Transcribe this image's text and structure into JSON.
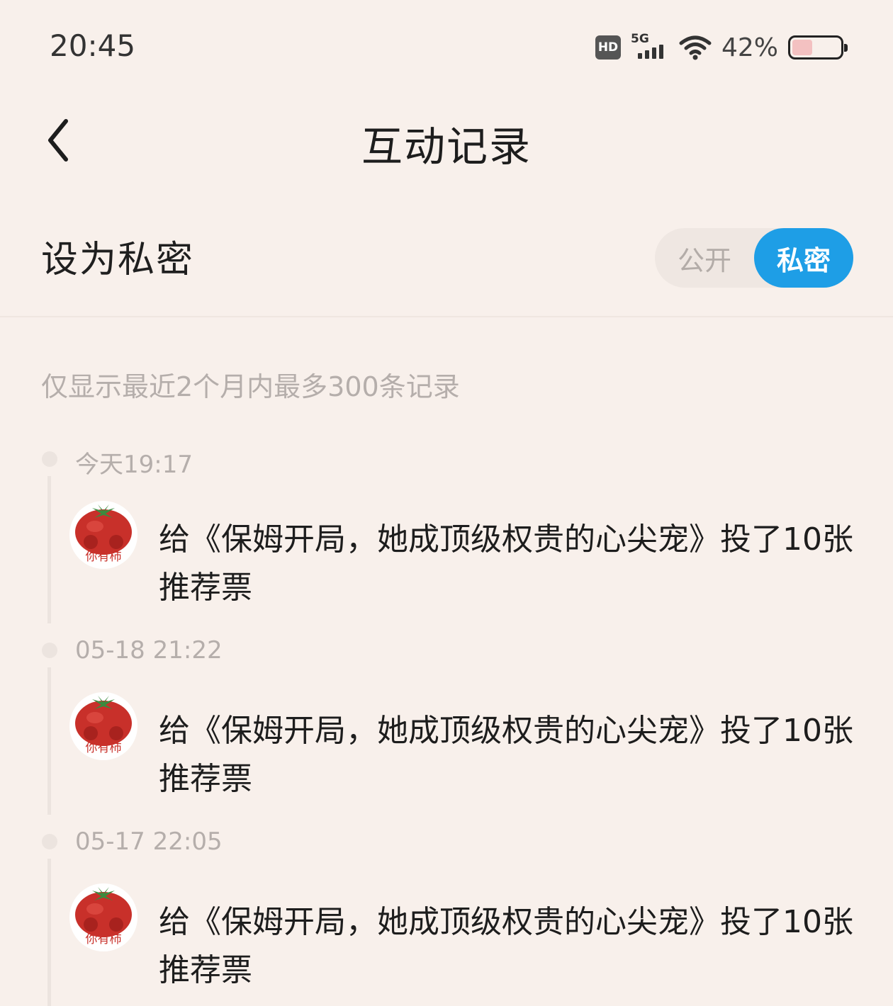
{
  "status_bar": {
    "time": "20:45",
    "hd_label": "HD",
    "network": "5G",
    "battery_percent": "42%",
    "battery_level": 0.42
  },
  "header": {
    "title": "互动记录",
    "back_icon": "chevron-left-icon"
  },
  "privacy": {
    "label": "设为私密",
    "public_option": "公开",
    "private_option": "私密",
    "selected": "私密",
    "accent_color": "#1e9ee6"
  },
  "hint": "仅显示最近2个月内最多300条记录",
  "records": [
    {
      "time": "今天19:17",
      "text": "给《保姆开局，她成顶级权贵的心尖宠》投了10张推荐票",
      "avatar_caption": "你有柿"
    },
    {
      "time": "05-18 21:22",
      "text": "给《保姆开局，她成顶级权贵的心尖宠》投了10张推荐票",
      "avatar_caption": "你有柿"
    },
    {
      "time": "05-17 22:05",
      "text": "给《保姆开局，她成顶级权贵的心尖宠》投了10张推荐票",
      "avatar_caption": "你有柿"
    }
  ]
}
